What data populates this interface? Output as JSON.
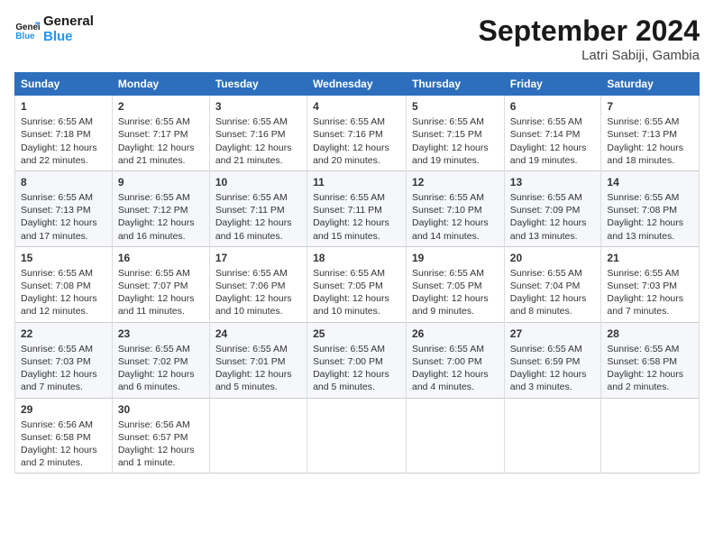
{
  "header": {
    "logo_line1": "General",
    "logo_line2": "Blue",
    "month": "September 2024",
    "location": "Latri Sabiji, Gambia"
  },
  "columns": [
    "Sunday",
    "Monday",
    "Tuesday",
    "Wednesday",
    "Thursday",
    "Friday",
    "Saturday"
  ],
  "weeks": [
    [
      {
        "day": "1",
        "rise": "Sunrise: 6:55 AM",
        "set": "Sunset: 7:18 PM",
        "light": "Daylight: 12 hours and 22 minutes."
      },
      {
        "day": "2",
        "rise": "Sunrise: 6:55 AM",
        "set": "Sunset: 7:17 PM",
        "light": "Daylight: 12 hours and 21 minutes."
      },
      {
        "day": "3",
        "rise": "Sunrise: 6:55 AM",
        "set": "Sunset: 7:16 PM",
        "light": "Daylight: 12 hours and 21 minutes."
      },
      {
        "day": "4",
        "rise": "Sunrise: 6:55 AM",
        "set": "Sunset: 7:16 PM",
        "light": "Daylight: 12 hours and 20 minutes."
      },
      {
        "day": "5",
        "rise": "Sunrise: 6:55 AM",
        "set": "Sunset: 7:15 PM",
        "light": "Daylight: 12 hours and 19 minutes."
      },
      {
        "day": "6",
        "rise": "Sunrise: 6:55 AM",
        "set": "Sunset: 7:14 PM",
        "light": "Daylight: 12 hours and 19 minutes."
      },
      {
        "day": "7",
        "rise": "Sunrise: 6:55 AM",
        "set": "Sunset: 7:13 PM",
        "light": "Daylight: 12 hours and 18 minutes."
      }
    ],
    [
      {
        "day": "8",
        "rise": "Sunrise: 6:55 AM",
        "set": "Sunset: 7:13 PM",
        "light": "Daylight: 12 hours and 17 minutes."
      },
      {
        "day": "9",
        "rise": "Sunrise: 6:55 AM",
        "set": "Sunset: 7:12 PM",
        "light": "Daylight: 12 hours and 16 minutes."
      },
      {
        "day": "10",
        "rise": "Sunrise: 6:55 AM",
        "set": "Sunset: 7:11 PM",
        "light": "Daylight: 12 hours and 16 minutes."
      },
      {
        "day": "11",
        "rise": "Sunrise: 6:55 AM",
        "set": "Sunset: 7:11 PM",
        "light": "Daylight: 12 hours and 15 minutes."
      },
      {
        "day": "12",
        "rise": "Sunrise: 6:55 AM",
        "set": "Sunset: 7:10 PM",
        "light": "Daylight: 12 hours and 14 minutes."
      },
      {
        "day": "13",
        "rise": "Sunrise: 6:55 AM",
        "set": "Sunset: 7:09 PM",
        "light": "Daylight: 12 hours and 13 minutes."
      },
      {
        "day": "14",
        "rise": "Sunrise: 6:55 AM",
        "set": "Sunset: 7:08 PM",
        "light": "Daylight: 12 hours and 13 minutes."
      }
    ],
    [
      {
        "day": "15",
        "rise": "Sunrise: 6:55 AM",
        "set": "Sunset: 7:08 PM",
        "light": "Daylight: 12 hours and 12 minutes."
      },
      {
        "day": "16",
        "rise": "Sunrise: 6:55 AM",
        "set": "Sunset: 7:07 PM",
        "light": "Daylight: 12 hours and 11 minutes."
      },
      {
        "day": "17",
        "rise": "Sunrise: 6:55 AM",
        "set": "Sunset: 7:06 PM",
        "light": "Daylight: 12 hours and 10 minutes."
      },
      {
        "day": "18",
        "rise": "Sunrise: 6:55 AM",
        "set": "Sunset: 7:05 PM",
        "light": "Daylight: 12 hours and 10 minutes."
      },
      {
        "day": "19",
        "rise": "Sunrise: 6:55 AM",
        "set": "Sunset: 7:05 PM",
        "light": "Daylight: 12 hours and 9 minutes."
      },
      {
        "day": "20",
        "rise": "Sunrise: 6:55 AM",
        "set": "Sunset: 7:04 PM",
        "light": "Daylight: 12 hours and 8 minutes."
      },
      {
        "day": "21",
        "rise": "Sunrise: 6:55 AM",
        "set": "Sunset: 7:03 PM",
        "light": "Daylight: 12 hours and 7 minutes."
      }
    ],
    [
      {
        "day": "22",
        "rise": "Sunrise: 6:55 AM",
        "set": "Sunset: 7:03 PM",
        "light": "Daylight: 12 hours and 7 minutes."
      },
      {
        "day": "23",
        "rise": "Sunrise: 6:55 AM",
        "set": "Sunset: 7:02 PM",
        "light": "Daylight: 12 hours and 6 minutes."
      },
      {
        "day": "24",
        "rise": "Sunrise: 6:55 AM",
        "set": "Sunset: 7:01 PM",
        "light": "Daylight: 12 hours and 5 minutes."
      },
      {
        "day": "25",
        "rise": "Sunrise: 6:55 AM",
        "set": "Sunset: 7:00 PM",
        "light": "Daylight: 12 hours and 5 minutes."
      },
      {
        "day": "26",
        "rise": "Sunrise: 6:55 AM",
        "set": "Sunset: 7:00 PM",
        "light": "Daylight: 12 hours and 4 minutes."
      },
      {
        "day": "27",
        "rise": "Sunrise: 6:55 AM",
        "set": "Sunset: 6:59 PM",
        "light": "Daylight: 12 hours and 3 minutes."
      },
      {
        "day": "28",
        "rise": "Sunrise: 6:55 AM",
        "set": "Sunset: 6:58 PM",
        "light": "Daylight: 12 hours and 2 minutes."
      }
    ],
    [
      {
        "day": "29",
        "rise": "Sunrise: 6:56 AM",
        "set": "Sunset: 6:58 PM",
        "light": "Daylight: 12 hours and 2 minutes."
      },
      {
        "day": "30",
        "rise": "Sunrise: 6:56 AM",
        "set": "Sunset: 6:57 PM",
        "light": "Daylight: 12 hours and 1 minute."
      },
      {
        "day": "",
        "rise": "",
        "set": "",
        "light": ""
      },
      {
        "day": "",
        "rise": "",
        "set": "",
        "light": ""
      },
      {
        "day": "",
        "rise": "",
        "set": "",
        "light": ""
      },
      {
        "day": "",
        "rise": "",
        "set": "",
        "light": ""
      },
      {
        "day": "",
        "rise": "",
        "set": "",
        "light": ""
      }
    ]
  ]
}
